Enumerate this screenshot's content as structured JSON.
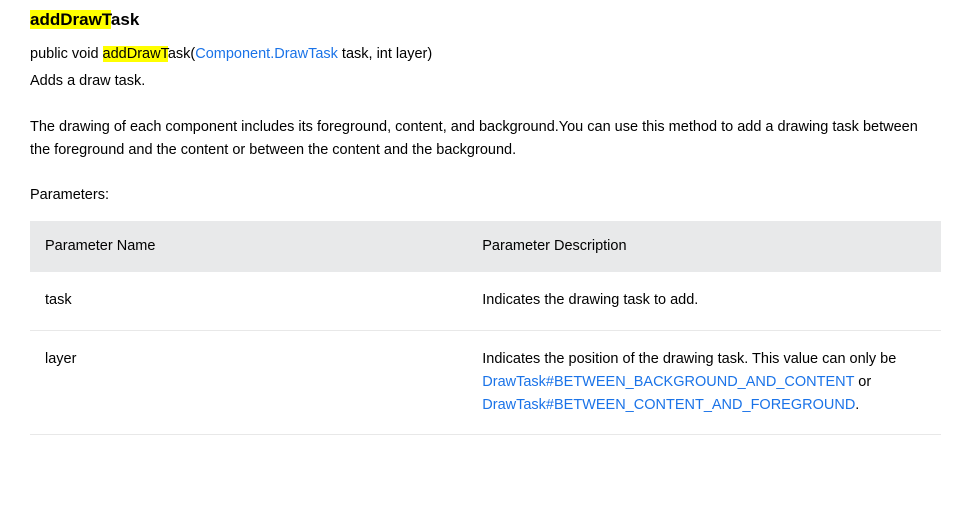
{
  "title": {
    "highlighted": "addDrawT",
    "rest": "ask"
  },
  "signature": {
    "pre": "public void ",
    "highlighted": "addDrawT",
    "afterHighlight": "ask(",
    "paramTypeLink": "Component.DrawTask",
    "postLink": " task, int layer)"
  },
  "summary": "Adds a draw task.",
  "description": "The drawing of each component includes its foreground, content, and background.You can use this method to add a drawing task between the foreground and the content or between the content and the background.",
  "parametersLabel": "Parameters:",
  "tableHeaders": {
    "name": "Parameter Name",
    "desc": "Parameter Description"
  },
  "params": {
    "task": {
      "name": "task",
      "desc": "Indicates the drawing task to add."
    },
    "layer": {
      "name": "layer",
      "descPre": "Indicates the position of the drawing task. This value can only be ",
      "link1": "DrawTask#BETWEEN_BACKGROUND_AND_CONTENT",
      "mid": " or ",
      "link2": "DrawTask#BETWEEN_CONTENT_AND_FOREGROUND",
      "post": "."
    }
  }
}
